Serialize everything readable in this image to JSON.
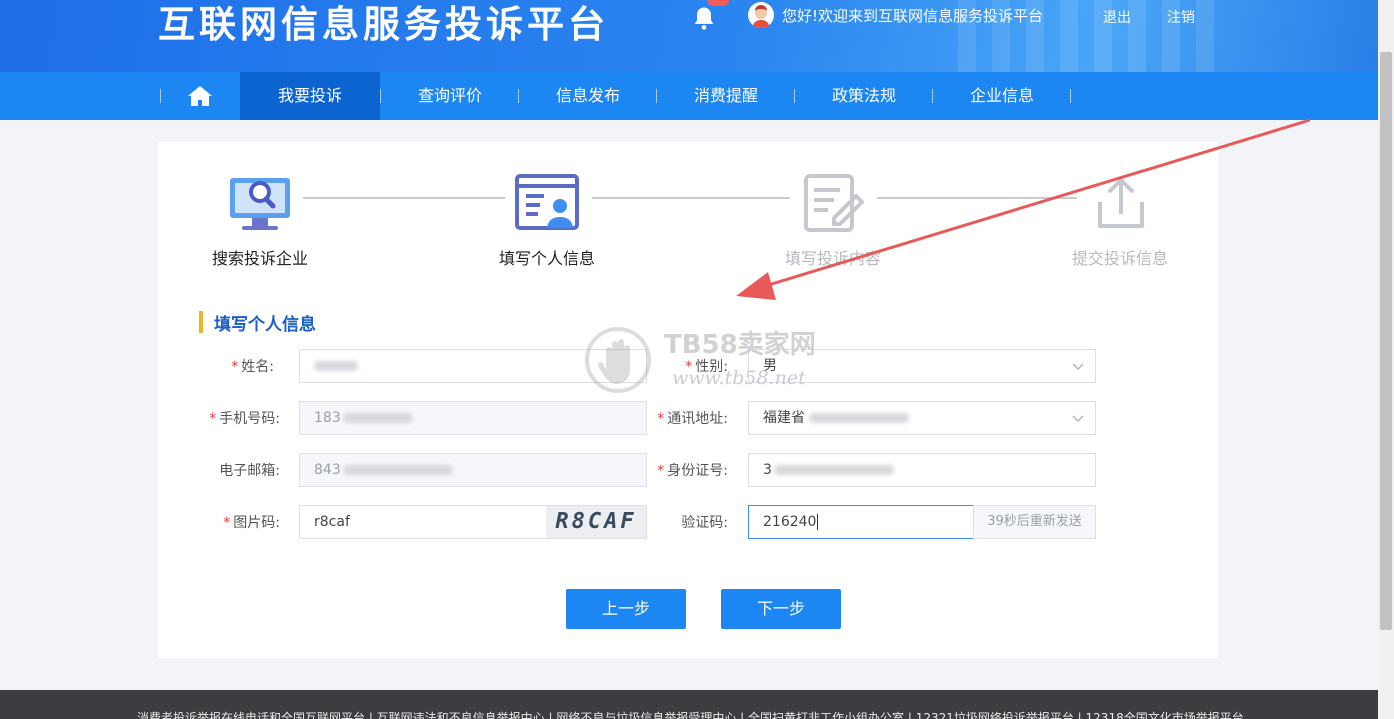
{
  "header": {
    "title": "互联网信息服务投诉平台",
    "welcome": "您好!欢迎来到互联网信息服务投诉平台",
    "logout": "退出",
    "cancel_account": "注销"
  },
  "nav": {
    "items": [
      {
        "label": "我要投诉"
      },
      {
        "label": "查询评价"
      },
      {
        "label": "信息发布"
      },
      {
        "label": "消费提醒"
      },
      {
        "label": "政策法规"
      },
      {
        "label": "企业信息"
      }
    ]
  },
  "steps": [
    {
      "label": "搜索投诉企业",
      "state": "done"
    },
    {
      "label": "填写个人信息",
      "state": "current"
    },
    {
      "label": "填写投诉内容",
      "state": "todo"
    },
    {
      "label": "提交投诉信息",
      "state": "todo"
    }
  ],
  "section_title": "填写个人信息",
  "form": {
    "name": {
      "label": "姓名:",
      "required": true
    },
    "gender": {
      "label": "性别:",
      "required": true,
      "value": "男"
    },
    "phone": {
      "label": "手机号码:",
      "required": true,
      "value_prefix": "183"
    },
    "address": {
      "label": "通讯地址:",
      "required": true,
      "value_prefix": "福建省"
    },
    "email": {
      "label": "电子邮箱:",
      "required": false,
      "value_prefix": "843"
    },
    "id_card": {
      "label": "身份证号:",
      "required": true,
      "value_prefix": "3"
    },
    "captcha_input": {
      "label": "图片码:",
      "required": true,
      "value": "r8caf"
    },
    "captcha_image": "R8CAF",
    "sms_code": {
      "label": "验证码:",
      "required": false,
      "value": "216240"
    },
    "resend": "39秒后重新发送"
  },
  "buttons": {
    "prev": "上一步",
    "next": "下一步"
  },
  "watermark": {
    "name": "TB58卖家网",
    "url": "www.tb58.net"
  },
  "footer": {
    "links": "消费者投诉举报在线电话和全国互联网平台 | 互联网违法和不良信息举报中心 | 网络不良与垃圾信息举报受理中心 | 全国扫黄打非工作小组办公室 | 12321垃圾网络投诉举报平台 | 12318全国文化市场举报平台"
  },
  "colors": {
    "primary": "#1c86f2",
    "nav_active": "#0c64d0",
    "section_accent": "#f0b429",
    "required": "#e03b3b",
    "annotation_arrow": "#e85a5a"
  }
}
